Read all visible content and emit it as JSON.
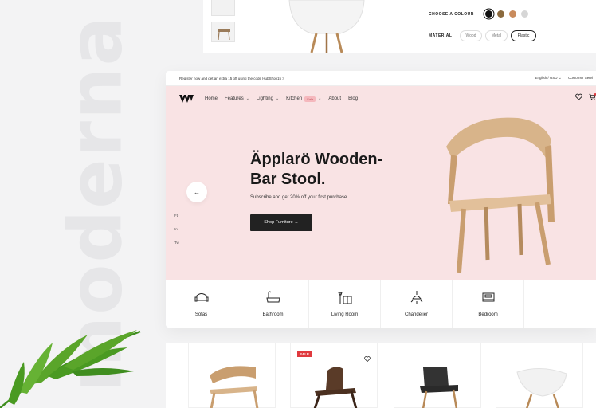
{
  "background_word": "moderna",
  "product_options": {
    "colour_label": "CHOOSE A COLOUR",
    "colours": [
      "#111111",
      "#8b6a3e",
      "#c98b5c",
      "#c0c0c0"
    ],
    "material_label": "MATERIAL",
    "materials": [
      {
        "label": "Wood",
        "selected": false
      },
      {
        "label": "Metal",
        "selected": false
      },
      {
        "label": "Plastic",
        "selected": true
      }
    ]
  },
  "topbar": {
    "promo": "Register now and get an extra 15 off using the code HubShop15 >",
    "language": "English / USD",
    "service": "Customer Servi"
  },
  "nav": {
    "items": [
      "Home",
      "Features",
      "Lighting",
      "Kitchen",
      "About",
      "Blog"
    ],
    "sale_badge": "Sale",
    "icons": [
      "heart-icon",
      "cart-icon"
    ]
  },
  "hero": {
    "title": "Äpplarö Wooden-Bar Stool.",
    "subtitle": "Subscribe and get 20% off your first purchase.",
    "button": "Shop Furniture",
    "button_arrow": "→",
    "prev_arrow": "←",
    "social": [
      "Fb",
      "In",
      "Tw"
    ]
  },
  "categories": [
    "Sofas",
    "Bathroom",
    "Living Room",
    "Chandelier",
    "Bedroom"
  ],
  "products": {
    "sale_tag": "SALE"
  },
  "colors": {
    "hero_bg": "#f9e3e4",
    "sale_red": "#e0393e",
    "accent_pink": "#f5b8bd"
  }
}
